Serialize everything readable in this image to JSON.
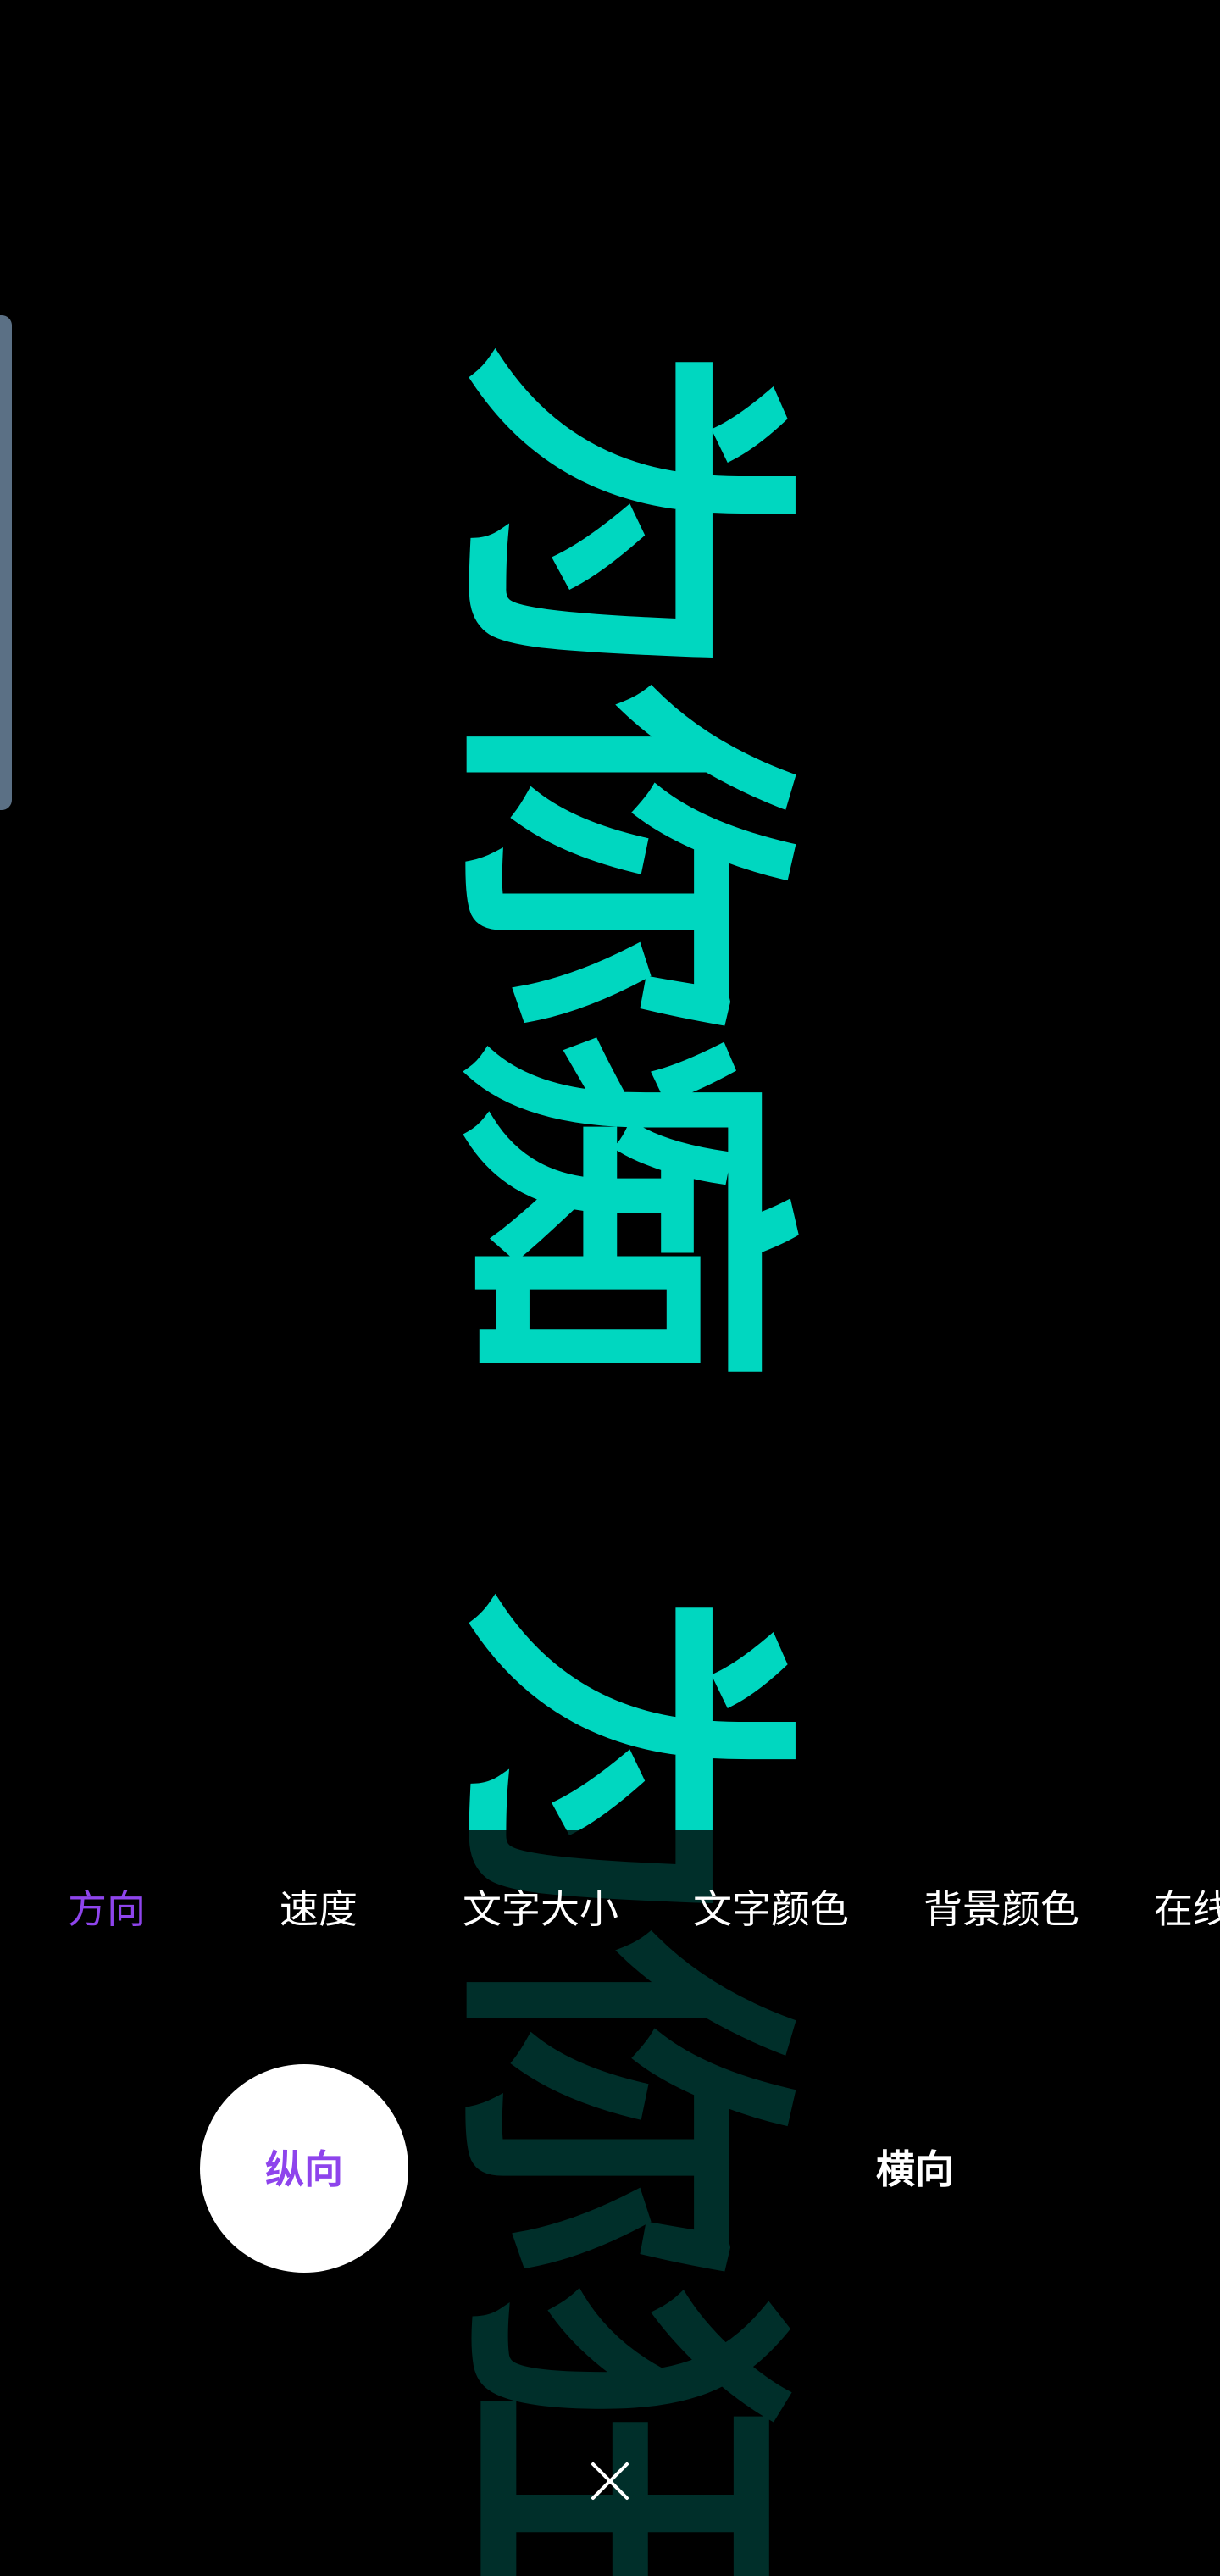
{
  "marquee": {
    "text_first": "为你痴",
    "text_second": "为你狂",
    "color": "#00D7C0",
    "background": "#000000",
    "orientation": "vertical"
  },
  "tabs": [
    {
      "label": "方向",
      "active": true
    },
    {
      "label": "速度",
      "active": false
    },
    {
      "label": "文字大小",
      "active": false
    },
    {
      "label": "文字颜色",
      "active": false
    },
    {
      "label": "背景颜色",
      "active": false
    },
    {
      "label": "在线",
      "active": false
    }
  ],
  "direction_options": {
    "selected": "纵向",
    "other": "横向"
  },
  "colors": {
    "accent": "#8E44EC",
    "handle": "#5B7085"
  },
  "icons": {
    "close": "close-icon"
  }
}
